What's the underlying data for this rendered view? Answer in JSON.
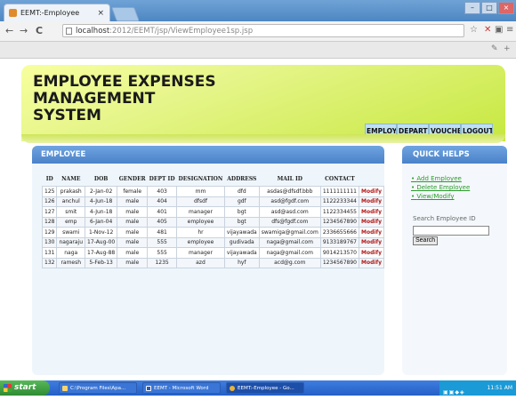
{
  "browser": {
    "tab_title": "EEMT:-Employee",
    "tab_close": "×",
    "url_host": "localhost",
    "url_path": ":2012/EEMT/jsp/ViewEmployee1sp.jsp",
    "nav": {
      "back": "←",
      "forward": "→",
      "reload": "C"
    },
    "window_buttons": {
      "minimize": "–",
      "maximize": "□",
      "close": "×"
    }
  },
  "site": {
    "title_line1": "EMPLOYEE EXPENSES MANAGEMENT",
    "title_line2": "SYSTEM",
    "menu": [
      "EMPLOYEE",
      "DEPARTMENT",
      "VOUCHER",
      "LOGOUT"
    ]
  },
  "employee_panel": {
    "title": "EMPLOYEE",
    "columns": [
      "ID",
      "NAME",
      "DOB",
      "GENDER",
      "DEPT ID",
      "DESIGNATION",
      "ADDRESS",
      "MAIL ID",
      "CONTACT"
    ],
    "rows": [
      {
        "id": "125",
        "name": "prakash",
        "dob": "2-Jan-02",
        "gender": "female",
        "dept": "403",
        "designation": "mm",
        "address": "dfd",
        "mail": "asdas@dfsdf.bbb",
        "contact": "1111111111",
        "action": "Modify"
      },
      {
        "id": "126",
        "name": "anchul",
        "dob": "4-Jun-18",
        "gender": "male",
        "dept": "404",
        "designation": "dfsdf",
        "address": "gdf",
        "mail": "asd@fgdf.com",
        "contact": "1122233344",
        "action": "Modify"
      },
      {
        "id": "127",
        "name": "smit",
        "dob": "4-Jun-18",
        "gender": "male",
        "dept": "401",
        "designation": "manager",
        "address": "bgt",
        "mail": "asd@asd.com",
        "contact": "1122334455",
        "action": "Modify"
      },
      {
        "id": "128",
        "name": "emp",
        "dob": "6-Jan-04",
        "gender": "male",
        "dept": "405",
        "designation": "employee",
        "address": "bgt",
        "mail": "dfs@fgdf.com",
        "contact": "1234567890",
        "action": "Modify"
      },
      {
        "id": "129",
        "name": "swami",
        "dob": "1-Nov-12",
        "gender": "male",
        "dept": "481",
        "designation": "hr",
        "address": "vijayawada",
        "mail": "swamiga@gmail.com",
        "contact": "2336655666",
        "action": "Modify"
      },
      {
        "id": "130",
        "name": "nagaraju",
        "dob": "17-Aug-00",
        "gender": "male",
        "dept": "555",
        "designation": "employee",
        "address": "gudivada",
        "mail": "naga@gmail.com",
        "contact": "9133189767",
        "action": "Modify"
      },
      {
        "id": "131",
        "name": "naga",
        "dob": "17-Aug-88",
        "gender": "male",
        "dept": "555",
        "designation": "manager",
        "address": "vijayawada",
        "mail": "naga@gmail.com",
        "contact": "9014213570",
        "action": "Modify"
      },
      {
        "id": "132",
        "name": "ramesh",
        "dob": "5-Feb-13",
        "gender": "male",
        "dept": "1235",
        "designation": "azd",
        "address": "hyf",
        "mail": "acd@g.com",
        "contact": "1234567890",
        "action": "Modify"
      }
    ]
  },
  "quick_helps": {
    "title": "QUICK HELPS",
    "links": [
      "Add Employee",
      "Delete Employee",
      "View/Modify"
    ],
    "search_label": "Search Employee ID",
    "search_value": "",
    "search_button": "Search"
  },
  "taskbar": {
    "start": "start",
    "tasks": [
      "C:\\Program Files\\Apa...",
      "EEMT - Microsoft Word",
      "EEMT:-Employee - Go..."
    ],
    "clock": "11:51 AM"
  }
}
